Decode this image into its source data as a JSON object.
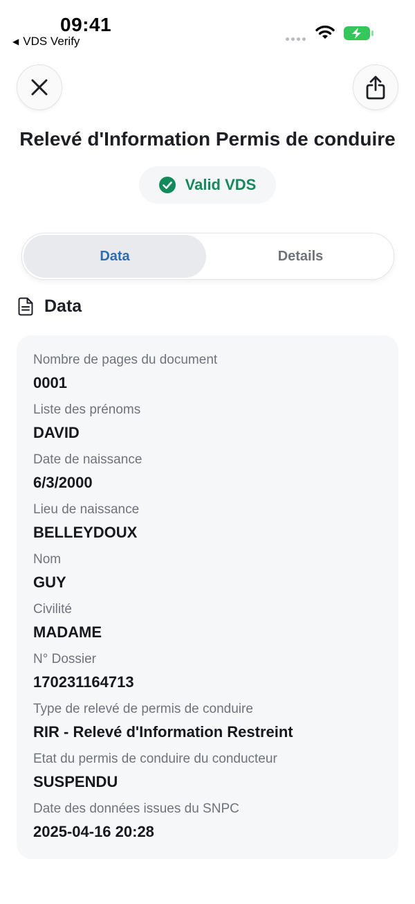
{
  "status_bar": {
    "time": "09:41",
    "back_app": "VDS Verify"
  },
  "header": {
    "title": "Relevé d'Information Permis de conduire",
    "status_badge": "Valid VDS",
    "status_color": "#138a5a"
  },
  "tabs": [
    {
      "label": "Data",
      "active": true
    },
    {
      "label": "Details",
      "active": false
    }
  ],
  "section": {
    "title": "Data"
  },
  "fields": [
    {
      "label": "Nombre de pages du document",
      "value": "0001"
    },
    {
      "label": "Liste des prénoms",
      "value": "DAVID"
    },
    {
      "label": "Date de naissance",
      "value": "6/3/2000"
    },
    {
      "label": "Lieu de naissance",
      "value": "BELLEYDOUX"
    },
    {
      "label": "Nom",
      "value": "GUY"
    },
    {
      "label": "Civilité",
      "value": "MADAME"
    },
    {
      "label": "N° Dossier",
      "value": "170231164713"
    },
    {
      "label": "Type de relevé de permis de conduire",
      "value": "RIR - Relevé d'Information Restreint"
    },
    {
      "label": "Etat du permis de conduire du conducteur",
      "value": "SUSPENDU"
    },
    {
      "label": "Date des données issues du SNPC",
      "value": "2025-04-16 20:28"
    }
  ],
  "icons": {
    "close": "close-icon",
    "share": "share-icon",
    "valid": "check-circle-icon",
    "section": "document-icon",
    "wifi": "wifi-icon",
    "battery": "battery-charging-icon"
  },
  "colors": {
    "accent": "#2c6db4",
    "valid": "#138a5a",
    "battery": "#34c759"
  }
}
